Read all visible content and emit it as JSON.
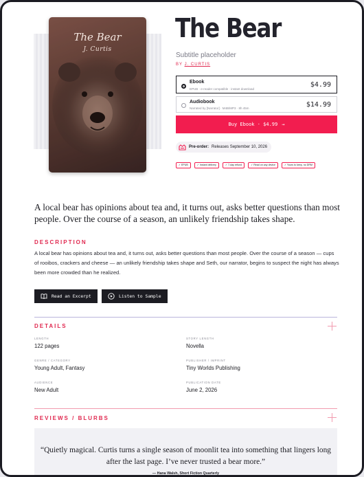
{
  "book": {
    "cover_title": "The Bear",
    "cover_author": "J. Curtis",
    "title": "The Bear",
    "subtitle": "Subtitle placeholder",
    "by_label": "BY",
    "author": "J. CURTIS"
  },
  "formats": [
    {
      "name": "Ebook",
      "desc": "EPUB · e-reader compatible · instant download",
      "price": "$4.99",
      "selected": true
    },
    {
      "name": "Audiobook",
      "desc": "Narrated by [Narrator] · M4B/MP3 · 8h 45m",
      "price": "$14.99",
      "selected": false
    }
  ],
  "buy": {
    "label": "Buy Ebook · $4.99",
    "arrow": "→"
  },
  "preorder": {
    "label": "Pre-order:",
    "text": "Releases September 10, 2026"
  },
  "chips": [
    "✓ EPUB",
    "✓ Instant delivery",
    "✓ 7-day refund",
    "✓ Read on any device",
    "✓ Yours to keep, no DRM"
  ],
  "lead": "A local bear has opinions about tea and, it turns out, asks better questions than most people. Over the course of a season, an unlikely friendship takes shape.",
  "description": {
    "heading": "DESCRIPTION",
    "text": "A local bear has opinions about tea and, it turns out, asks better questions than most people.  Over the course of a season — cups of rooibos, crackers and cheese — an unlikely friendship takes shape and Seth, our narrator, begins to suspect the night has always been more crowded than he realized."
  },
  "actions": {
    "excerpt": "Read an Excerpt",
    "listen": "Listen to Sample"
  },
  "details": {
    "heading": "DETAILS",
    "items": [
      {
        "label": "LENGTH",
        "value": "122 pages"
      },
      {
        "label": "STORY LENGTH",
        "value": "Novella"
      },
      {
        "label": "GENRE / CATEGORY",
        "value": "Young Adult, Fantasy"
      },
      {
        "label": "PUBLISHER / IMPRINT",
        "value": "Tiny Worlds Publishing"
      },
      {
        "label": "AUDIENCE",
        "value": "New Adult"
      },
      {
        "label": "PUBLICATION DATE",
        "value": "June 2, 2026"
      }
    ]
  },
  "reviews": {
    "heading": "REVIEWS / BLURBS",
    "quote": "“Quietly magical. Curtis turns a single season of moonlit tea into something that lingers long after the last page. I’ve never trusted a bear more.”",
    "source": "— Hana Walsh, Short Fiction Quarterly"
  },
  "icons": {
    "book": "open-book-icon",
    "play": "play-circle-icon",
    "preorder": "preorder-icon",
    "expand": "plus-icon"
  },
  "colors": {
    "accent": "#f21d4f",
    "dark": "#1c1c22",
    "divider": "#b9b4dc"
  }
}
